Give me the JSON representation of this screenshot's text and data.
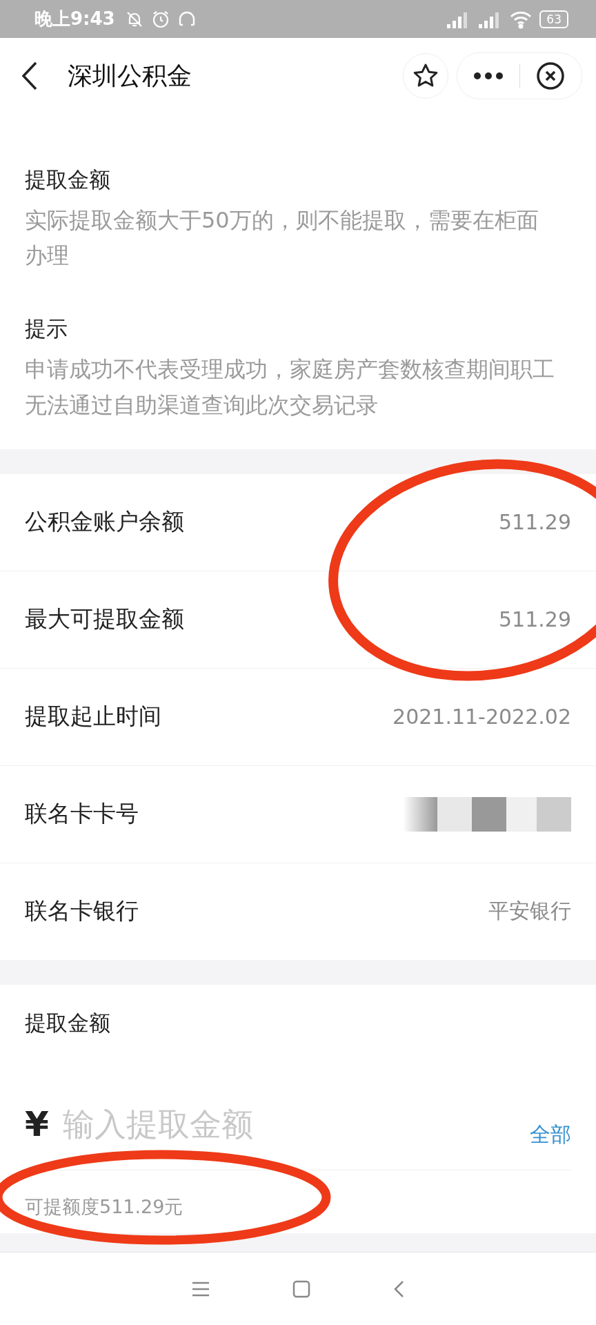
{
  "status_bar": {
    "time": "晚上9:43",
    "battery": "63"
  },
  "nav": {
    "title": "深圳公积金"
  },
  "notes": [
    {
      "title": "提取金额",
      "text": "实际提取金额大于50万的，则不能提取，需要在柜面办理"
    },
    {
      "title": "提示",
      "text": "申请成功不代表受理成功，家庭房产套数核查期间职工无法通过自助渠道查询此次交易记录"
    }
  ],
  "info_rows": [
    {
      "label": "公积金账户余额",
      "value": "511.29",
      "kind": "text"
    },
    {
      "label": "最大可提取金额",
      "value": "511.29",
      "kind": "text"
    },
    {
      "label": "提取起止时间",
      "value": "2021.11-2022.02",
      "kind": "text"
    },
    {
      "label": "联名卡卡号",
      "kind": "masked"
    },
    {
      "label": "联名卡银行",
      "value": "平安银行",
      "kind": "text"
    }
  ],
  "amount": {
    "title": "提取金额",
    "currency": "¥",
    "placeholder": "输入提取金额",
    "all_button": "全部",
    "limit": "可提额度511.29元"
  }
}
